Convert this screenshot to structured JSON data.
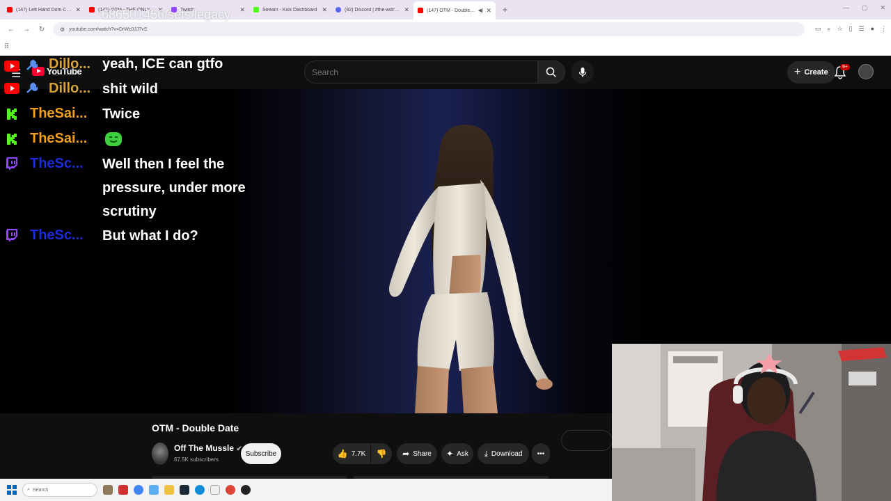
{
  "browser": {
    "tabs": [
      {
        "title": "(147) Left Hand Dom CALLS OUT",
        "favicon_color": "#ff0000",
        "active": false
      },
      {
        "title": "(147) OTM - THE ONLY WAY TO",
        "favicon_color": "#ff0000",
        "active": false
      },
      {
        "title": "Twitch",
        "favicon_color": "#9146ff",
        "active": false
      },
      {
        "title": "Stream - Kick Dashboard",
        "favicon_color": "#53fc18",
        "active": false
      },
      {
        "title": "(92) Discord | #the-astronomy",
        "favicon_color": "#5865f2",
        "active": false
      },
      {
        "title": "(147) OTM - Double Date -",
        "favicon_color": "#ff0000",
        "active": true
      }
    ],
    "url": "youtube.com/watch?v=DrWc0JJ7vS",
    "overlay_url_text": "686501456/sets/legacy"
  },
  "youtube": {
    "logo_text": "YouTube",
    "search_placeholder": "Search",
    "create_label": "Create",
    "notification_count": "9+",
    "video": {
      "title": "OTM - Double Date",
      "channel": "Off The Mussle",
      "subscribers": "67.5K subscribers",
      "subscribe_label": "Subscribe",
      "likes": "7.7K",
      "share_label": "Share",
      "ask_label": "Ask",
      "download_label": "Download"
    }
  },
  "chat": [
    {
      "platform": "youtube",
      "user": "Dillo...",
      "user_color": "#d9a23a",
      "text": "yeah, ICE can gtfo"
    },
    {
      "platform": "youtube",
      "user": "Dillo...",
      "user_color": "#d9a23a",
      "text": "shit wild"
    },
    {
      "platform": "kick",
      "user": "TheSai...",
      "user_color": "#f0a020",
      "text": "Twice"
    },
    {
      "platform": "kick",
      "user": "TheSai...",
      "user_color": "#f0a020",
      "text": "",
      "emote": "green-smile-emote"
    },
    {
      "platform": "twitch",
      "user": "TheSc...",
      "user_color": "#1e2bd8",
      "text": "Well then I feel the pressure, under more scrutiny"
    },
    {
      "platform": "twitch",
      "user": "TheSc...",
      "user_color": "#1e2bd8",
      "text": "But what I do?"
    }
  ],
  "taskbar": {
    "search_label": "Search"
  }
}
